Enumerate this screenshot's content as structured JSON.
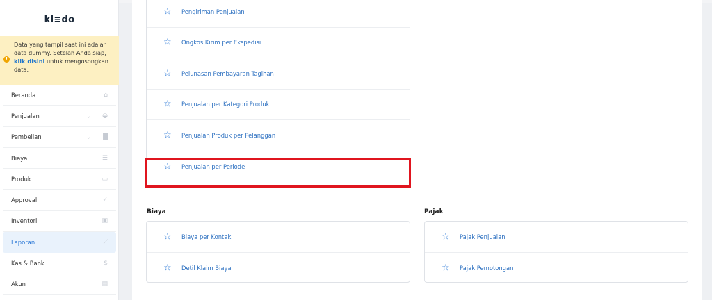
{
  "sidebar": {
    "logo": "kl≡do",
    "notice": {
      "text_before": "Data yang tampil saat ini adalah data dummy. Setelah Anda siap, ",
      "link": "klik disini",
      "text_after": " untuk mengosongkan data."
    },
    "items": [
      {
        "label": "Beranda",
        "icon": "home-icon"
      },
      {
        "label": "Penjualan",
        "icon": "basket-icon"
      },
      {
        "label": "Pembelian",
        "icon": "bag-icon"
      },
      {
        "label": "Biaya",
        "icon": "list-icon"
      },
      {
        "label": "Produk",
        "icon": "box-icon"
      },
      {
        "label": "Approval",
        "icon": "check-icon"
      },
      {
        "label": "Inventori",
        "icon": "briefcase-icon"
      },
      {
        "label": "Laporan",
        "icon": "chart-icon"
      },
      {
        "label": "Kas & Bank",
        "icon": "dollar-icon"
      },
      {
        "label": "Akun",
        "icon": "card-icon"
      }
    ],
    "active_item": "Laporan"
  },
  "reports": {
    "penjualan": [
      "Pengiriman Penjualan",
      "Ongkos Kirim per Ekspedisi",
      "Pelunasan Pembayaran Tagihan",
      "Penjualan per Kategori Produk",
      "Penjualan Produk per Pelanggan",
      "Penjualan per Periode"
    ],
    "biaya_title": "Biaya",
    "biaya": [
      "Biaya per Kontak",
      "Detil Klaim Biaya"
    ],
    "pajak_title": "Pajak",
    "pajak": [
      "Pajak Penjualan",
      "Pajak Pemotongan"
    ]
  },
  "colors": {
    "accent": "#2b78d6",
    "highlight": "#e0151f",
    "notice_bg": "#fdf0c2"
  }
}
